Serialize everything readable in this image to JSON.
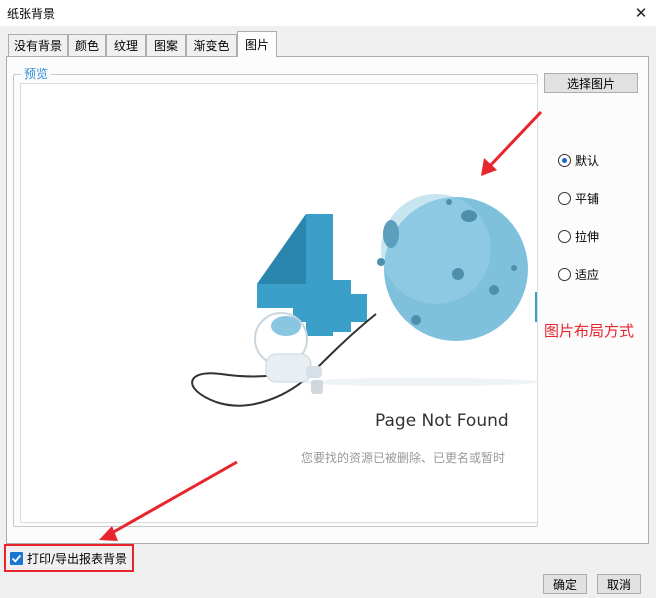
{
  "window": {
    "title": "纸张背景",
    "close_glyph": "✕"
  },
  "tabs": [
    {
      "label": "没有背景"
    },
    {
      "label": "颜色"
    },
    {
      "label": "纹理"
    },
    {
      "label": "图案"
    },
    {
      "label": "渐变色"
    },
    {
      "label": "图片"
    }
  ],
  "active_tab": "图片",
  "preview": {
    "legend": "预览",
    "image": {
      "digit": "4",
      "title": "Page Not Found",
      "subtitle": "您要找的资源已被删除、已更名或暂时"
    }
  },
  "select_image_button": "选择图片",
  "layout_options": [
    {
      "label": "默认",
      "selected": true
    },
    {
      "label": "平铺",
      "selected": false
    },
    {
      "label": "拉伸",
      "selected": false
    },
    {
      "label": "适应",
      "selected": false
    }
  ],
  "annotation_label": "图片布局方式",
  "print_checkbox": {
    "label": "打印/导出报表背景",
    "checked": true
  },
  "footer": {
    "ok": "确定",
    "cancel": "取消"
  },
  "colors": {
    "annotation_red": "#e8242c",
    "checkbox_blue": "#1976d2",
    "planet_blue": "#7fc1dd",
    "digit_blue": "#3aa0c9"
  },
  "icons": [
    "close-icon",
    "checkmark-icon",
    "astronaut-icon",
    "planet-icon",
    "arrow-icon"
  ]
}
